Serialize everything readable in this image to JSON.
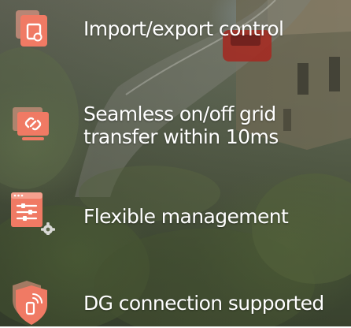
{
  "features": [
    {
      "label": "Import/export control",
      "icon": "meter-icon"
    },
    {
      "label_lines": [
        "Seamless on/off grid",
        "transfer within 10ms"
      ],
      "icon": "link-monitor-icon"
    },
    {
      "label": "Flexible management",
      "icon": "settings-window-icon"
    },
    {
      "label": "DG connection supported",
      "icon": "shield-device-icon"
    }
  ],
  "colors": {
    "accent": "#f07a64",
    "accent_light": "#f5a08e",
    "text": "#ffffff"
  }
}
